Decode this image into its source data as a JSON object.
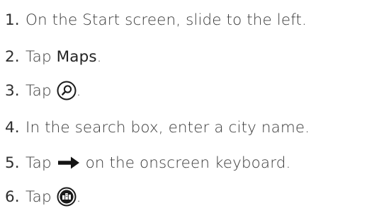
{
  "steps": [
    {
      "number": "1.",
      "text": "On the Start screen, slide to the left."
    },
    {
      "number": "2.",
      "before": "Tap ",
      "bold": "Maps",
      "after": "."
    },
    {
      "number": "3.",
      "before": "Tap ",
      "icon": "search-circle-icon",
      "after": "."
    },
    {
      "number": "4.",
      "text": "In the search box, enter a city name."
    },
    {
      "number": "5.",
      "before": "Tap ",
      "icon": "right-arrow-icon",
      "after": " on the onscreen keyboard."
    },
    {
      "number": "6.",
      "before": "Tap ",
      "icon": "city-buildings-circle-icon",
      "after": "."
    }
  ]
}
